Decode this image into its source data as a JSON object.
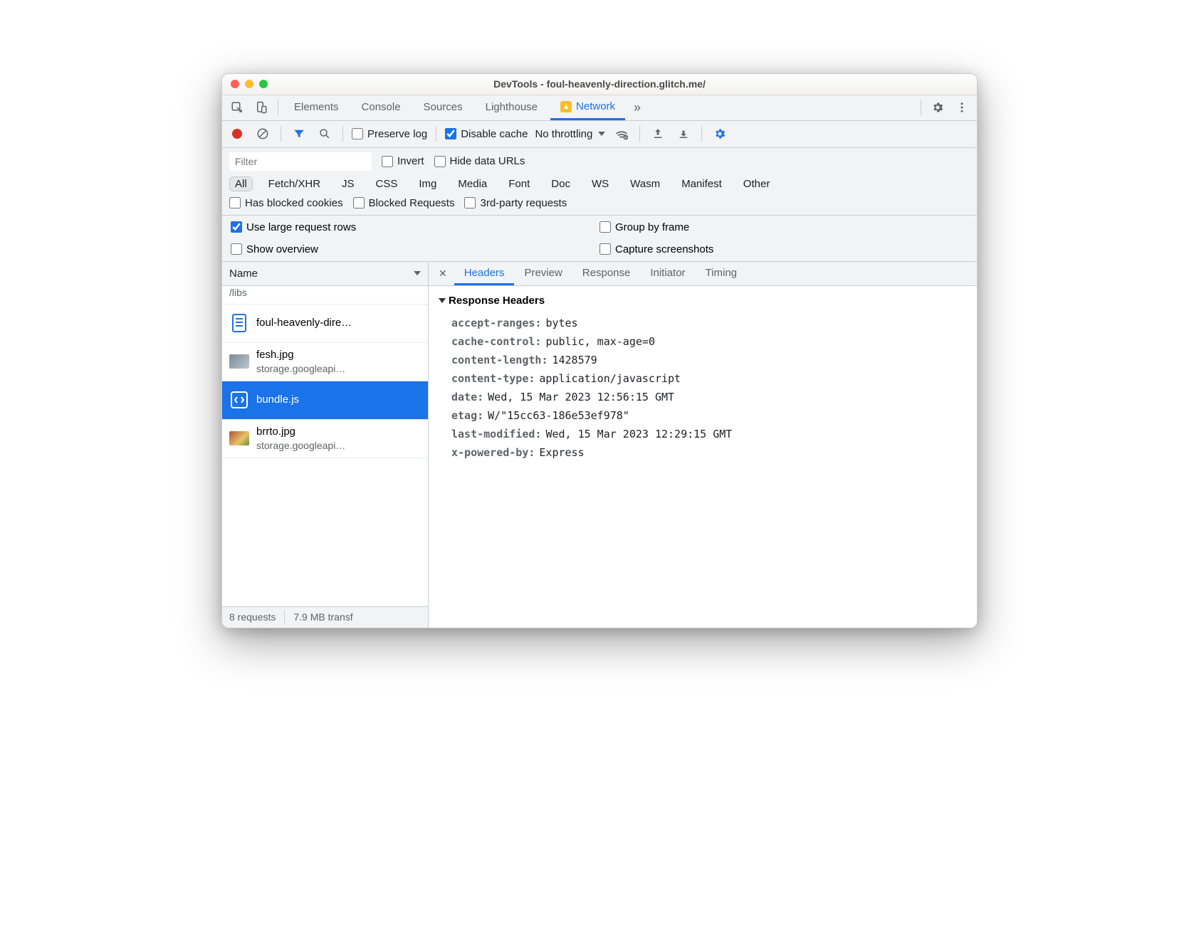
{
  "window": {
    "title": "DevTools - foul-heavenly-direction.glitch.me/"
  },
  "top_tabs": {
    "items": [
      "Elements",
      "Console",
      "Sources",
      "Lighthouse",
      "Network"
    ],
    "active": "Network",
    "more": "»"
  },
  "toolbar2": {
    "preserve_log": "Preserve log",
    "disable_cache": "Disable cache",
    "throttling": "No throttling"
  },
  "filterbar": {
    "filter_placeholder": "Filter",
    "invert": "Invert",
    "hide_data_urls": "Hide data URLs",
    "types": [
      "All",
      "Fetch/XHR",
      "JS",
      "CSS",
      "Img",
      "Media",
      "Font",
      "Doc",
      "WS",
      "Wasm",
      "Manifest",
      "Other"
    ],
    "has_blocked_cookies": "Has blocked cookies",
    "blocked_requests": "Blocked Requests",
    "third_party": "3rd-party requests"
  },
  "options": {
    "use_large_rows": "Use large request rows",
    "group_by_frame": "Group by frame",
    "show_overview": "Show overview",
    "capture_screenshots": "Capture screenshots"
  },
  "requests": {
    "header": "Name",
    "items": [
      {
        "name": "/libs",
        "sub": "",
        "kind": "topcut"
      },
      {
        "name": "foul-heavenly-dire…",
        "sub": "",
        "kind": "doc"
      },
      {
        "name": "fesh.jpg",
        "sub": "storage.googleapi…",
        "kind": "img"
      },
      {
        "name": "bundle.js",
        "sub": "",
        "kind": "js",
        "selected": true
      },
      {
        "name": "brrto.jpg",
        "sub": "storage.googleapi…",
        "kind": "img"
      }
    ]
  },
  "detail": {
    "tabs": [
      "Headers",
      "Preview",
      "Response",
      "Initiator",
      "Timing"
    ],
    "active": "Headers",
    "section": "Response Headers",
    "headers": [
      {
        "k": "accept-ranges",
        "v": "bytes"
      },
      {
        "k": "cache-control",
        "v": "public, max-age=0"
      },
      {
        "k": "content-length",
        "v": "1428579"
      },
      {
        "k": "content-type",
        "v": "application/javascript"
      },
      {
        "k": "date",
        "v": "Wed, 15 Mar 2023 12:56:15 GMT"
      },
      {
        "k": "etag",
        "v": "W/\"15cc63-186e53ef978\""
      },
      {
        "k": "last-modified",
        "v": "Wed, 15 Mar 2023 12:29:15 GMT"
      },
      {
        "k": "x-powered-by",
        "v": "Express"
      }
    ]
  },
  "status": {
    "requests": "8 requests",
    "transfer": "7.9 MB transf"
  }
}
